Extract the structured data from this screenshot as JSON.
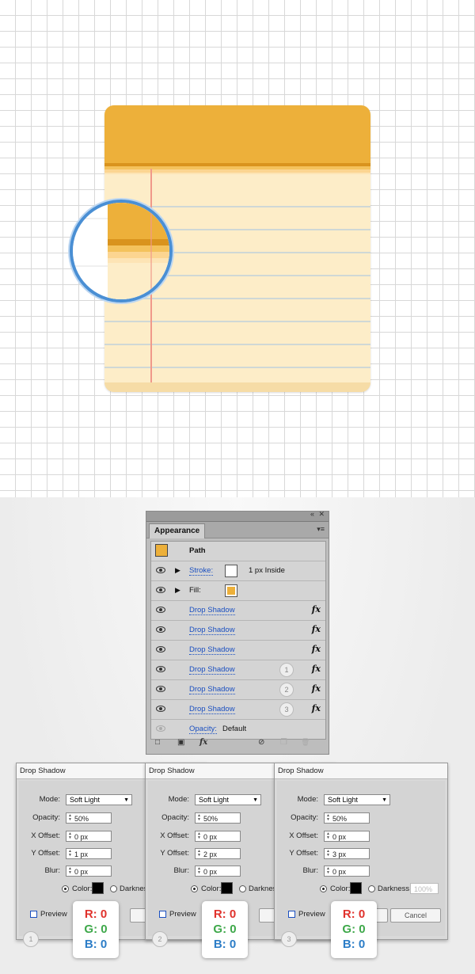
{
  "appearance_panel": {
    "collapse_icon": "«",
    "close_icon": "✕",
    "tab_title": "Appearance",
    "menu_icon": "▾≡",
    "rows": [
      {
        "label": "Path"
      },
      {
        "label": "Stroke:",
        "value": "1 px  Inside"
      },
      {
        "label": "Fill:"
      },
      {
        "label": "Drop Shadow",
        "fx": "fx"
      },
      {
        "label": "Drop Shadow",
        "fx": "fx"
      },
      {
        "label": "Drop Shadow",
        "fx": "fx"
      },
      {
        "label": "Drop Shadow",
        "fx": "fx",
        "badge": "1"
      },
      {
        "label": "Drop Shadow",
        "fx": "fx",
        "badge": "2"
      },
      {
        "label": "Drop Shadow",
        "fx": "fx",
        "badge": "3"
      },
      {
        "label": "Opacity:",
        "value": "Default"
      }
    ],
    "footer": {
      "new_stroke": "□",
      "new_fill": "▣",
      "fx": "fx",
      "clear": "⊘",
      "duplicate": "❐",
      "delete": "🗑"
    },
    "colors": {
      "fill": "#edb03a",
      "stroke": "#ffffff"
    }
  },
  "dialogs": [
    {
      "title": "Drop Shadow",
      "mode_label": "Mode:",
      "mode": "Soft Light",
      "opacity_label": "Opacity:",
      "opacity": "50%",
      "x_label": "X Offset:",
      "x": "0 px",
      "y_label": "Y Offset:",
      "y": "1 px",
      "blur_label": "Blur:",
      "blur": "0 px",
      "color_label": "Color:",
      "darkness_label": "Darkness",
      "preview_label": "Preview",
      "badge": "1",
      "rgb": {
        "r": "R: 0",
        "g": "G: 0",
        "b": "B: 0"
      }
    },
    {
      "title": "Drop Shadow",
      "mode_label": "Mode:",
      "mode": "Soft Light",
      "opacity_label": "Opacity:",
      "opacity": "50%",
      "x_label": "X Offset:",
      "x": "0 px",
      "y_label": "Y Offset:",
      "y": "2 px",
      "blur_label": "Blur:",
      "blur": "0 px",
      "color_label": "Color:",
      "darkness_label": "Darkness",
      "preview_label": "Preview",
      "badge": "2",
      "rgb": {
        "r": "R: 0",
        "g": "G: 0",
        "b": "B: 0"
      }
    },
    {
      "title": "Drop Shadow",
      "mode_label": "Mode:",
      "mode": "Soft Light",
      "opacity_label": "Opacity:",
      "opacity": "50%",
      "x_label": "X Offset:",
      "x": "0 px",
      "y_label": "Y Offset:",
      "y": "3 px",
      "blur_label": "Blur:",
      "blur": "0 px",
      "color_label": "Color:",
      "darkness_label": "Darkness:",
      "darkness_value": "100%",
      "preview_label": "Preview",
      "cancel_label": "Cancel",
      "badge": "3",
      "rgb": {
        "r": "R: 0",
        "g": "G: 0",
        "b": "B: 0"
      }
    }
  ]
}
